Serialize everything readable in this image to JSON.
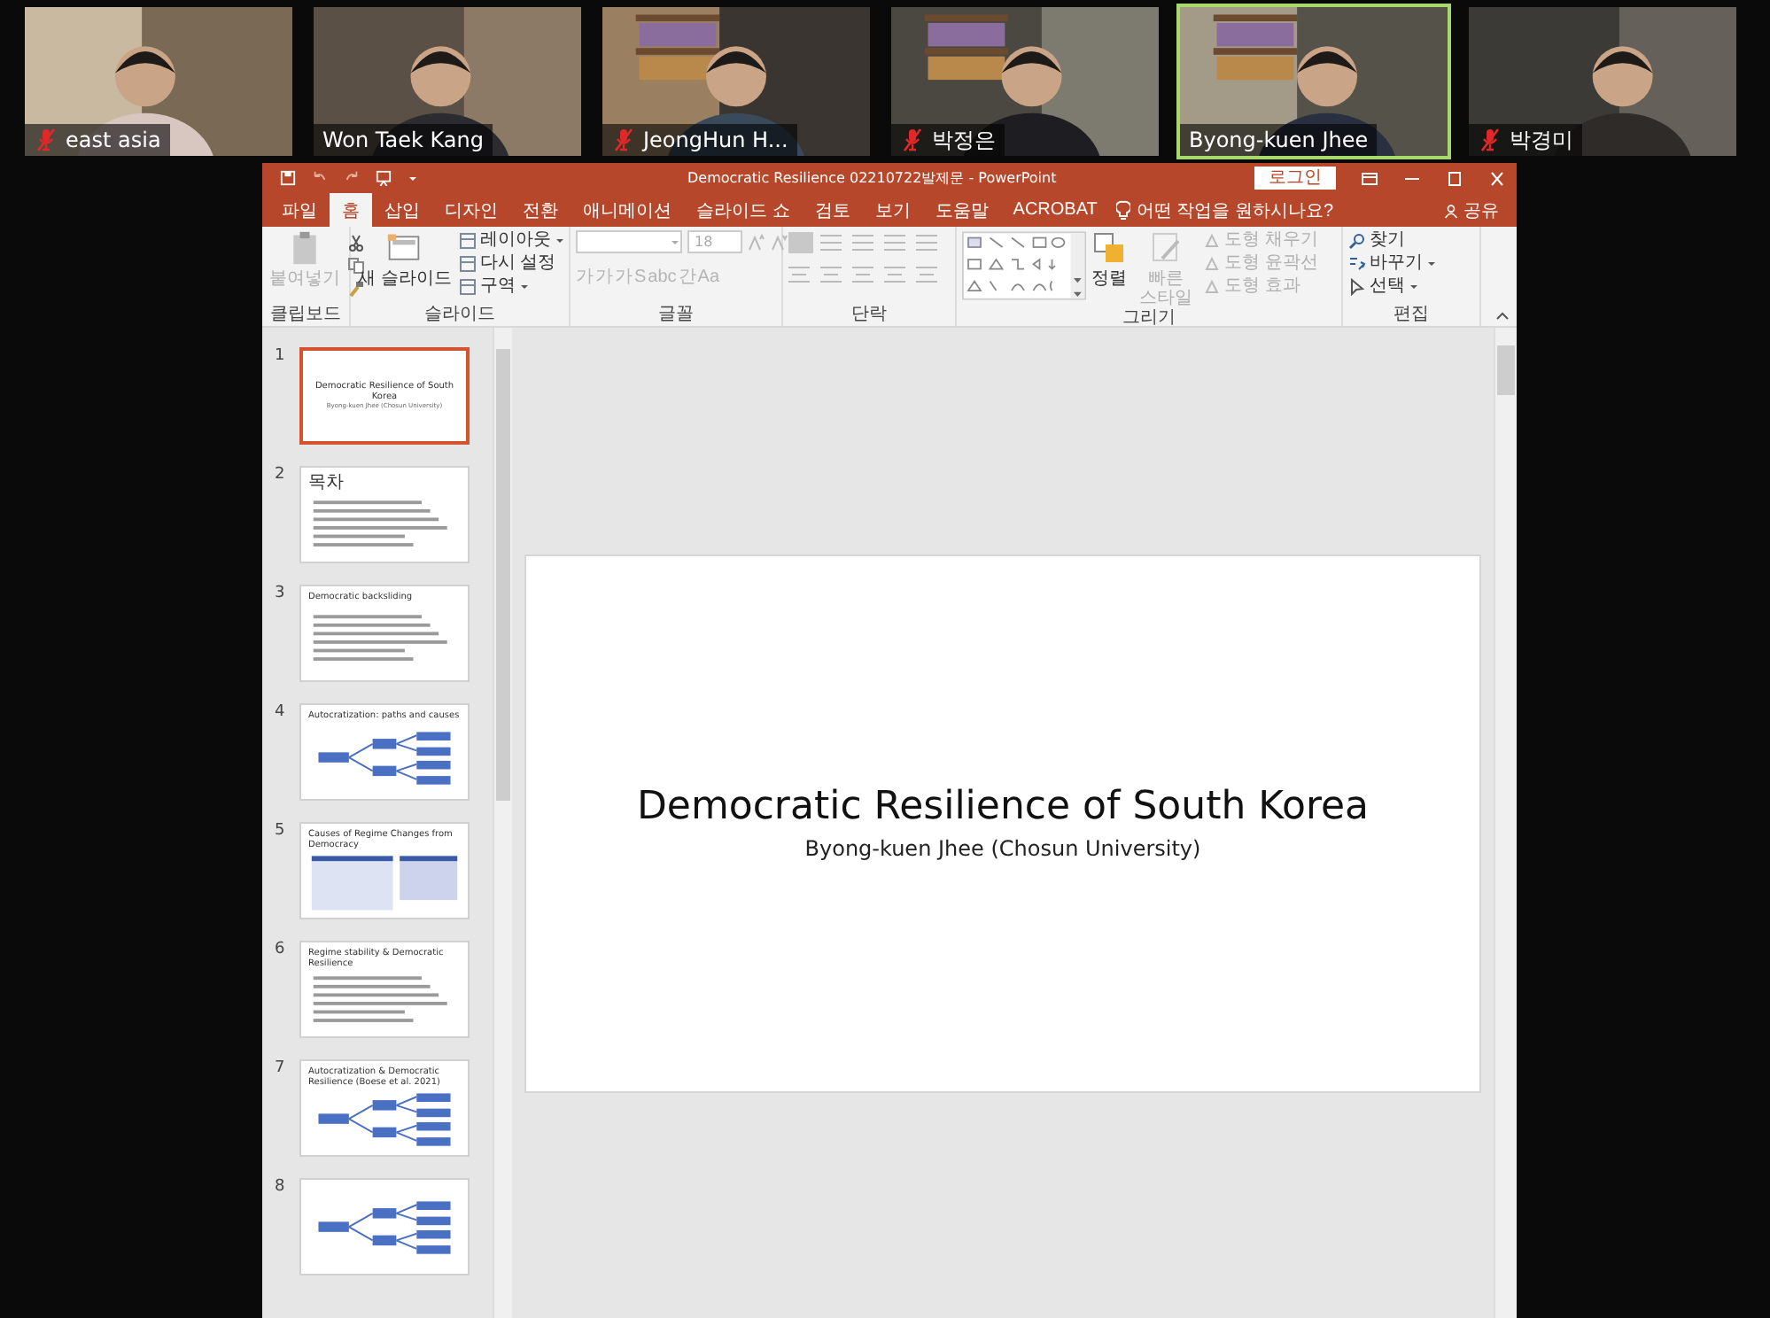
{
  "participants": [
    {
      "name": "east asia",
      "muted": true,
      "speaking": false
    },
    {
      "name": "Won Taek Kang",
      "muted": false,
      "speaking": false
    },
    {
      "name": "JeongHun H...",
      "muted": true,
      "speaking": false
    },
    {
      "name": "박정은",
      "muted": true,
      "speaking": false
    },
    {
      "name": "Byong-kuen Jhee",
      "muted": false,
      "speaking": true
    },
    {
      "name": "박경미",
      "muted": true,
      "speaking": false
    }
  ],
  "window": {
    "title": "Democratic Resilience 02210722발제문  -  PowerPoint",
    "login": "로그인"
  },
  "tabs": [
    {
      "label": "파일",
      "selected": false
    },
    {
      "label": "홈",
      "selected": true
    },
    {
      "label": "삽입",
      "selected": false
    },
    {
      "label": "디자인",
      "selected": false
    },
    {
      "label": "전환",
      "selected": false
    },
    {
      "label": "애니메이션",
      "selected": false
    },
    {
      "label": "슬라이드 쇼",
      "selected": false
    },
    {
      "label": "검토",
      "selected": false
    },
    {
      "label": "보기",
      "selected": false
    },
    {
      "label": "도움말",
      "selected": false
    },
    {
      "label": "ACROBAT",
      "selected": false
    }
  ],
  "tell_me": "어떤 작업을 원하시나요?",
  "share": "공유",
  "ribbon": {
    "clipboard": {
      "label": "클립보드",
      "paste": {
        "label": "붙여넣기",
        "disabled": true
      }
    },
    "slides": {
      "label": "슬라이드",
      "new_slide": "새 슬라이드",
      "items": [
        {
          "label": "레이아웃",
          "dropdown": true
        },
        {
          "label": "다시 설정",
          "dropdown": false
        },
        {
          "label": "구역",
          "dropdown": true
        }
      ]
    },
    "font": {
      "label": "글꼴",
      "size": "18",
      "buttons": [
        "가",
        "가",
        "가",
        "S",
        "abc",
        "간",
        "Aa"
      ]
    },
    "paragraph": {
      "label": "단락"
    },
    "drawing": {
      "label": "그리기",
      "arrange": "정렬",
      "quick_styles": {
        "label": "빠른 스타일",
        "disabled": true
      },
      "shape_options": [
        {
          "label": "도형 채우기",
          "disabled": true
        },
        {
          "label": "도형 윤곽선",
          "disabled": true
        },
        {
          "label": "도형 효과",
          "disabled": true
        }
      ]
    },
    "editing": {
      "label": "편집",
      "items": [
        {
          "label": "찾기",
          "dropdown": false
        },
        {
          "label": "바꾸기",
          "dropdown": true
        },
        {
          "label": "선택",
          "dropdown": true
        }
      ]
    }
  },
  "thumbnails": [
    {
      "number": "1",
      "kind": "title",
      "title": "Democratic Resilience of South Korea",
      "subtitle": "Byong-kuen Jhee (Chosun University)",
      "selected": true
    },
    {
      "number": "2",
      "kind": "bullets",
      "title": "목차",
      "selected": false
    },
    {
      "number": "3",
      "kind": "bullets",
      "title": "Democratic backsliding",
      "selected": false
    },
    {
      "number": "4",
      "kind": "diagram",
      "title": "Autocratization: paths and causes",
      "selected": false
    },
    {
      "number": "5",
      "kind": "table",
      "title": "Causes of Regime Changes from Democracy",
      "selected": false
    },
    {
      "number": "6",
      "kind": "bullets",
      "title": "Regime stability & Democratic Resilience",
      "selected": false
    },
    {
      "number": "7",
      "kind": "diagram",
      "title": "Autocratization & Democratic Resilience (Boese et al. 2021)",
      "selected": false
    },
    {
      "number": "8",
      "kind": "diagram",
      "selected": false
    }
  ],
  "slide": {
    "title": "Democratic Resilience of South Korea",
    "subtitle": "Byong-kuen Jhee (Chosun University)"
  }
}
